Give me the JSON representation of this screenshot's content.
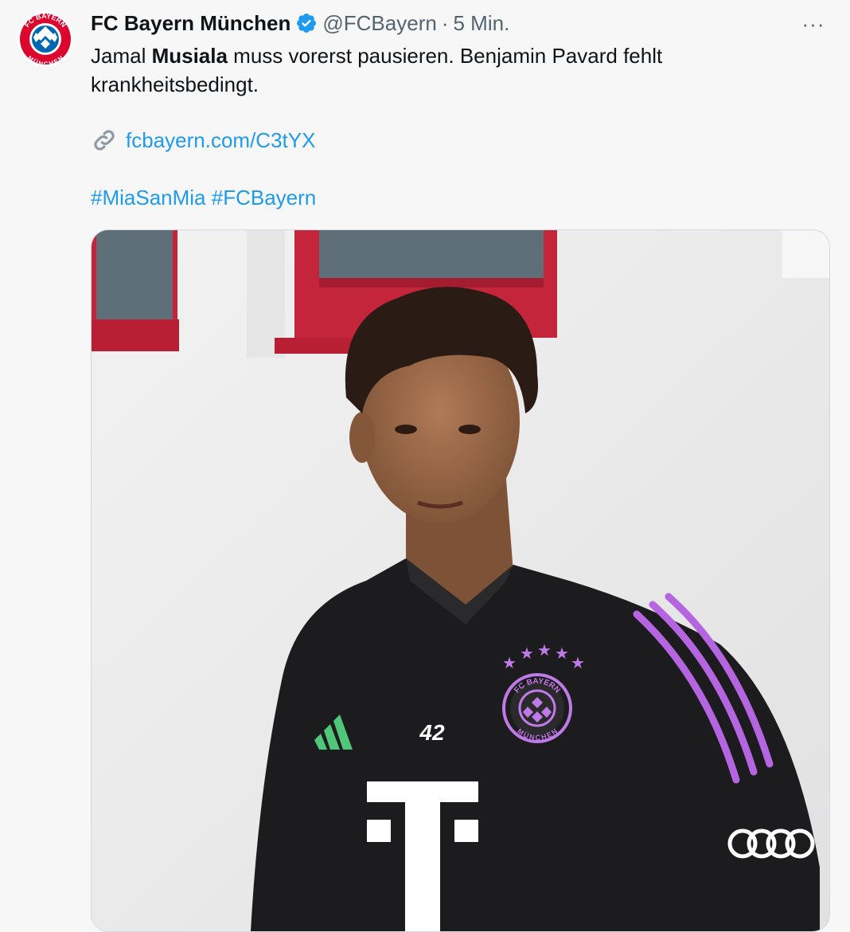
{
  "tweet": {
    "author_name": "FC Bayern München",
    "handle": "@FCBayern",
    "separator": "·",
    "timestamp": "5 Min.",
    "more_label": "···",
    "text_part1": "Jamal ",
    "text_bold": "Musiala",
    "text_part2": " muss vorerst pausieren. Benjamin Pavard fehlt krankheitsbedingt.",
    "link_text": "fcbayern.com/C3tYX",
    "hashtags": [
      "#MiaSanMia",
      "#FCBayern"
    ]
  },
  "avatar": {
    "crest_top": "FC BAYERN",
    "crest_bottom": "MÜNCHEN"
  },
  "media": {
    "shirt_number": "42",
    "crest_top": "FC BAYERN",
    "crest_bottom": "MÜNCHEN",
    "sponsor": "T"
  },
  "colors": {
    "link": "#1d9bf0",
    "verified": "#1d9bf0",
    "bayern_red": "#dc052d",
    "bayern_blue": "#0066b2",
    "jersey": "#1c1c1e",
    "stripes": "#b565e0"
  }
}
